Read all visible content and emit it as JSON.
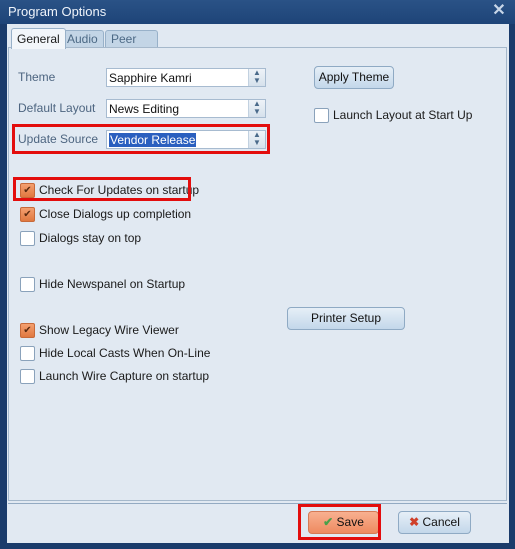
{
  "window": {
    "title": "Program Options",
    "close_icon": "close-icon"
  },
  "tabs": [
    {
      "label": "General",
      "active": true
    },
    {
      "label": "Audio",
      "active": false
    },
    {
      "label": "Peer Sharing",
      "active": false
    }
  ],
  "general": {
    "theme": {
      "label": "Theme",
      "value": "Sapphire Kamri"
    },
    "default_layout": {
      "label": "Default Layout",
      "value": "News Editing"
    },
    "update_source": {
      "label": "Update Source",
      "value": "Vendor Release"
    },
    "apply_theme_label": "Apply Theme",
    "launch_layout": {
      "label": "Launch Layout at Start Up",
      "checked": false
    },
    "checkboxes": [
      {
        "label": "Check For Updates on startup",
        "checked": true
      },
      {
        "label": "Close Dialogs up completion",
        "checked": true
      },
      {
        "label": "Dialogs stay on top",
        "checked": false
      },
      {
        "label": "Hide Newspanel on Startup",
        "checked": false
      },
      {
        "label": "Show Legacy Wire Viewer",
        "checked": true
      },
      {
        "label": "Hide Local Casts When On-Line",
        "checked": false
      },
      {
        "label": "Launch Wire Capture on startup",
        "checked": false
      }
    ],
    "printer_setup_label": "Printer Setup"
  },
  "footer": {
    "save_label": "Save",
    "cancel_label": "Cancel"
  },
  "icons": {
    "checkmark": "✔",
    "spin": "▲▼",
    "save": "✔",
    "cancel": "✖",
    "close": "✕"
  },
  "colors": {
    "highlight": "#e30d0d",
    "checked_box": "#e8864f",
    "title_bar": "#1e4478"
  }
}
